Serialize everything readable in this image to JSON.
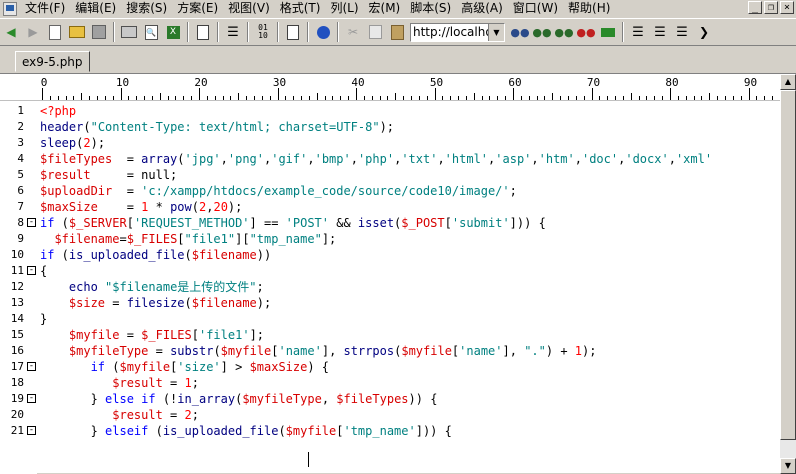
{
  "menubar": {
    "items": [
      "文件(F)",
      "编辑(E)",
      "搜索(S)",
      "方案(E)",
      "视图(V)",
      "格式(T)",
      "列(L)",
      "宏(M)",
      "脚本(S)",
      "高级(A)",
      "窗口(W)",
      "帮助(H)"
    ]
  },
  "toolbar": {
    "url_value": "http://localhos"
  },
  "tab": {
    "label": "ex9-5.php"
  },
  "ruler": {
    "labels": [
      "0",
      "10",
      "20",
      "30",
      "40",
      "50",
      "60",
      "70",
      "80",
      "90"
    ]
  },
  "code": {
    "lines": [
      {
        "n": "1",
        "fold": "",
        "segs": [
          [
            "tag",
            "<?php"
          ]
        ]
      },
      {
        "n": "2",
        "fold": "",
        "segs": [
          [
            "fn",
            "header"
          ],
          [
            "op",
            "("
          ],
          [
            "str",
            "\"Content-Type: text/html; charset=UTF-8\""
          ],
          [
            "op",
            ");"
          ]
        ]
      },
      {
        "n": "3",
        "fold": "",
        "segs": [
          [
            "fn",
            "sleep"
          ],
          [
            "op",
            "("
          ],
          [
            "num",
            "2"
          ],
          [
            "op",
            ");"
          ]
        ]
      },
      {
        "n": "4",
        "fold": "",
        "segs": [
          [
            "var",
            "$fileTypes"
          ],
          [
            "op",
            "  = "
          ],
          [
            "fn",
            "array"
          ],
          [
            "op",
            "("
          ],
          [
            "str",
            "'jpg'"
          ],
          [
            "op",
            ","
          ],
          [
            "str",
            "'png'"
          ],
          [
            "op",
            ","
          ],
          [
            "str",
            "'gif'"
          ],
          [
            "op",
            ","
          ],
          [
            "str",
            "'bmp'"
          ],
          [
            "op",
            ","
          ],
          [
            "str",
            "'php'"
          ],
          [
            "op",
            ","
          ],
          [
            "str",
            "'txt'"
          ],
          [
            "op",
            ","
          ],
          [
            "str",
            "'html'"
          ],
          [
            "op",
            ","
          ],
          [
            "str",
            "'asp'"
          ],
          [
            "op",
            ","
          ],
          [
            "str",
            "'htm'"
          ],
          [
            "op",
            ","
          ],
          [
            "str",
            "'doc'"
          ],
          [
            "op",
            ","
          ],
          [
            "str",
            "'docx'"
          ],
          [
            "op",
            ","
          ],
          [
            "str",
            "'xml'"
          ]
        ]
      },
      {
        "n": "5",
        "fold": "",
        "segs": [
          [
            "var",
            "$result"
          ],
          [
            "op",
            "     = null;"
          ]
        ]
      },
      {
        "n": "6",
        "fold": "",
        "segs": [
          [
            "var",
            "$uploadDir"
          ],
          [
            "op",
            "  = "
          ],
          [
            "str",
            "'c:/xampp/htdocs/example_code/source/code10/image/'"
          ],
          [
            "op",
            ";"
          ]
        ]
      },
      {
        "n": "7",
        "fold": "",
        "segs": [
          [
            "var",
            "$maxSize"
          ],
          [
            "op",
            "    = "
          ],
          [
            "num",
            "1"
          ],
          [
            "op",
            " * "
          ],
          [
            "fn",
            "pow"
          ],
          [
            "op",
            "("
          ],
          [
            "num",
            "2"
          ],
          [
            "op",
            ","
          ],
          [
            "num",
            "20"
          ],
          [
            "op",
            ");"
          ]
        ]
      },
      {
        "n": "8",
        "fold": "-",
        "segs": [
          [
            "kw",
            "if"
          ],
          [
            "op",
            " ("
          ],
          [
            "var",
            "$_SERVER"
          ],
          [
            "op",
            "["
          ],
          [
            "str",
            "'REQUEST_METHOD'"
          ],
          [
            "op",
            "] == "
          ],
          [
            "str",
            "'POST'"
          ],
          [
            "op",
            " && "
          ],
          [
            "fn",
            "isset"
          ],
          [
            "op",
            "("
          ],
          [
            "var",
            "$_POST"
          ],
          [
            "op",
            "["
          ],
          [
            "str",
            "'submit'"
          ],
          [
            "op",
            "])) {"
          ]
        ]
      },
      {
        "n": "9",
        "fold": "",
        "segs": [
          [
            "op",
            "  "
          ],
          [
            "var",
            "$filename"
          ],
          [
            "op",
            "="
          ],
          [
            "var",
            "$_FILES"
          ],
          [
            "op",
            "["
          ],
          [
            "str",
            "\"file1\""
          ],
          [
            "op",
            "]["
          ],
          [
            "str",
            "\"tmp_name\""
          ],
          [
            "op",
            "];"
          ]
        ]
      },
      {
        "n": "10",
        "fold": "",
        "segs": [
          [
            "kw",
            "if"
          ],
          [
            "op",
            " ("
          ],
          [
            "fn",
            "is_uploaded_file"
          ],
          [
            "op",
            "("
          ],
          [
            "var",
            "$filename"
          ],
          [
            "op",
            "))"
          ]
        ]
      },
      {
        "n": "11",
        "fold": "-",
        "segs": [
          [
            "op",
            "{"
          ]
        ]
      },
      {
        "n": "12",
        "fold": "",
        "segs": [
          [
            "op",
            "    "
          ],
          [
            "fn",
            "echo"
          ],
          [
            "op",
            " "
          ],
          [
            "str",
            "\"$filename是上传的文件\""
          ],
          [
            "op",
            ";"
          ]
        ]
      },
      {
        "n": "13",
        "fold": "",
        "segs": [
          [
            "op",
            "    "
          ],
          [
            "var",
            "$size"
          ],
          [
            "op",
            " = "
          ],
          [
            "fn",
            "filesize"
          ],
          [
            "op",
            "("
          ],
          [
            "var",
            "$filename"
          ],
          [
            "op",
            ");"
          ]
        ]
      },
      {
        "n": "14",
        "fold": "",
        "segs": [
          [
            "op",
            "}"
          ]
        ]
      },
      {
        "n": "15",
        "fold": "",
        "segs": [
          [
            "op",
            "    "
          ],
          [
            "var",
            "$myfile"
          ],
          [
            "op",
            " = "
          ],
          [
            "var",
            "$_FILES"
          ],
          [
            "op",
            "["
          ],
          [
            "str",
            "'file1'"
          ],
          [
            "op",
            "];"
          ]
        ]
      },
      {
        "n": "16",
        "fold": "",
        "segs": [
          [
            "op",
            "    "
          ],
          [
            "var",
            "$myfileType"
          ],
          [
            "op",
            " = "
          ],
          [
            "fn",
            "substr"
          ],
          [
            "op",
            "("
          ],
          [
            "var",
            "$myfile"
          ],
          [
            "op",
            "["
          ],
          [
            "str",
            "'name'"
          ],
          [
            "op",
            "], "
          ],
          [
            "fn",
            "strrpos"
          ],
          [
            "op",
            "("
          ],
          [
            "var",
            "$myfile"
          ],
          [
            "op",
            "["
          ],
          [
            "str",
            "'name'"
          ],
          [
            "op",
            "], "
          ],
          [
            "str",
            "\".\""
          ],
          [
            "op",
            ") + "
          ],
          [
            "num",
            "1"
          ],
          [
            "op",
            ");"
          ]
        ]
      },
      {
        "n": "17",
        "fold": "-",
        "segs": [
          [
            "op",
            "       "
          ],
          [
            "kw",
            "if"
          ],
          [
            "op",
            " ("
          ],
          [
            "var",
            "$myfile"
          ],
          [
            "op",
            "["
          ],
          [
            "str",
            "'size'"
          ],
          [
            "op",
            "] > "
          ],
          [
            "var",
            "$maxSize"
          ],
          [
            "op",
            ") {"
          ]
        ]
      },
      {
        "n": "18",
        "fold": "",
        "segs": [
          [
            "op",
            "          "
          ],
          [
            "var",
            "$result"
          ],
          [
            "op",
            " = "
          ],
          [
            "num",
            "1"
          ],
          [
            "op",
            ";"
          ]
        ]
      },
      {
        "n": "19",
        "fold": "-",
        "segs": [
          [
            "op",
            "       } "
          ],
          [
            "kw",
            "else if"
          ],
          [
            "op",
            " (!"
          ],
          [
            "fn",
            "in_array"
          ],
          [
            "op",
            "("
          ],
          [
            "var",
            "$myfileType"
          ],
          [
            "op",
            ", "
          ],
          [
            "var",
            "$fileTypes"
          ],
          [
            "op",
            ")) {"
          ]
        ]
      },
      {
        "n": "20",
        "fold": "",
        "segs": [
          [
            "op",
            "          "
          ],
          [
            "var",
            "$result"
          ],
          [
            "op",
            " = "
          ],
          [
            "num",
            "2"
          ],
          [
            "op",
            ";"
          ]
        ]
      },
      {
        "n": "21",
        "fold": "-",
        "segs": [
          [
            "op",
            "       } "
          ],
          [
            "kw",
            "elseif"
          ],
          [
            "op",
            " ("
          ],
          [
            "fn",
            "is_uploaded_file"
          ],
          [
            "op",
            "("
          ],
          [
            "var",
            "$myfile"
          ],
          [
            "op",
            "["
          ],
          [
            "str",
            "'tmp_name'"
          ],
          [
            "op",
            "])) {"
          ]
        ]
      }
    ]
  },
  "colors": {
    "keyword": "#0000ff",
    "variable": "#d70000",
    "string": "#008080",
    "number": "#ff0000"
  }
}
